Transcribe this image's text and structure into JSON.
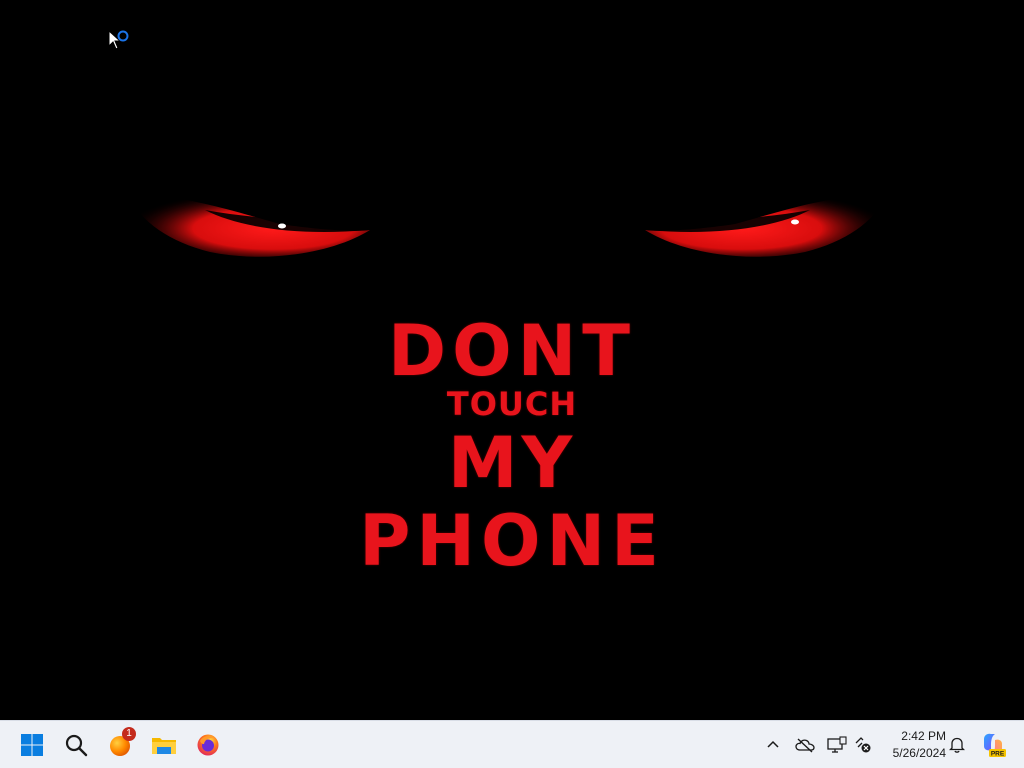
{
  "wallpaper": {
    "line1": "DONT",
    "line2": "TOUCH",
    "line3": "MY",
    "line4": "PHONE",
    "text_color": "#e8141c",
    "eye_color": "#e8141c",
    "background_color": "#000000"
  },
  "cursor": {
    "icon": "arrow-busy-cursor-icon"
  },
  "taskbar": {
    "background": "#eef1f6",
    "pinned": [
      {
        "name": "start",
        "icon": "windows-logo-icon"
      },
      {
        "name": "search",
        "icon": "search-icon"
      },
      {
        "name": "browser",
        "icon": "browser-app-icon",
        "badge": "1"
      },
      {
        "name": "file-explorer",
        "icon": "folder-icon"
      },
      {
        "name": "firefox",
        "icon": "firefox-icon"
      }
    ],
    "tray": {
      "icons": [
        "chevron-up-icon",
        "cloud-offline-icon",
        "display-icon",
        "network-disconnected-icon",
        "bell-icon",
        "copilot-icon"
      ],
      "time": "2:42 PM",
      "date": "5/26/2024",
      "copilot_label": "PRE"
    }
  }
}
